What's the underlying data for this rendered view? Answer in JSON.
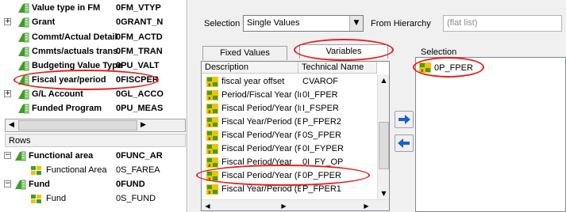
{
  "left_tree": {
    "items": [
      {
        "name": "Value type in FM",
        "tech": "0FM_VTYP",
        "expander": ""
      },
      {
        "name": "Grant",
        "tech": "0GRANT_N",
        "expander": "+"
      },
      {
        "name": "Commt/Actual Detail",
        "tech": "0FM_ACTD",
        "expander": ""
      },
      {
        "name": "Cmmts/actuals trans.",
        "tech": "0FM_TRAN",
        "expander": ""
      },
      {
        "name": "Budgeting Value Type",
        "tech": "0PU_VALT",
        "expander": ""
      },
      {
        "name": "Fiscal year/period",
        "tech": "0FISCPER",
        "expander": ""
      },
      {
        "name": "G/L Account",
        "tech": "0GL_ACCO",
        "expander": "+"
      },
      {
        "name": "Funded Program",
        "tech": "0PU_MEAS",
        "expander": ""
      }
    ],
    "rows_header": "Rows",
    "rows": [
      {
        "name": "Functional area",
        "tech": "0FUNC_AR",
        "expander": "−",
        "bold": true,
        "indent": 0
      },
      {
        "name": "Functional Area",
        "tech": "0S_FAREA",
        "expander": "",
        "bold": false,
        "indent": 1
      },
      {
        "name": "Fund",
        "tech": "0FUND",
        "expander": "−",
        "bold": true,
        "indent": 0
      },
      {
        "name": "Fund",
        "tech": "0S_FUND",
        "expander": "",
        "bold": false,
        "indent": 1
      }
    ]
  },
  "topbar": {
    "selection_label": "Selection",
    "selection_value": "Single Values",
    "hierarchy_label": "From Hierarchy",
    "hierarchy_value": "(flat list)"
  },
  "tabs": {
    "fixed_values": "Fixed Values",
    "variables": "Variables"
  },
  "list": {
    "col_description": "Description",
    "col_technical": "Technical Name",
    "rows": [
      {
        "desc": "fiscal year offset",
        "tech": "CVAROF"
      },
      {
        "desc": "Period/Fiscal Year (Int",
        "tech": "0I_FPER"
      },
      {
        "desc": "Fiscal Period/Year (Inte",
        "tech": "I_FSPER"
      },
      {
        "desc": "Fiscal Year/Period (Exi",
        "tech": "P_FPER2"
      },
      {
        "desc": "Fiscal Period/Year (Re",
        "tech": "0S_FPER"
      },
      {
        "desc": "Fiscal Period/Year (Re",
        "tech": "0I_FYPER"
      },
      {
        "desc": "Fiscal Period/Year",
        "tech": "0I_FY_OP"
      },
      {
        "desc": "Fiscal Period/Year (Re",
        "tech": "0P_FPER"
      },
      {
        "desc": "Fiscal Year/Period (Exi",
        "tech": "P_FPER1"
      }
    ]
  },
  "selection_panel": {
    "label": "Selection",
    "items": [
      {
        "name": "0P_FPER"
      }
    ]
  },
  "icons": {
    "arrow_right": "→",
    "arrow_left": "←",
    "combo_arrow": "▼",
    "scroll_left": "◀",
    "scroll_right": "▶",
    "scroll_up": "▲",
    "scroll_down": "▼"
  },
  "colors": {
    "highlight_ring": "#e8201c",
    "arrow_blue": "#1a5fd6",
    "variable_icon_yellow": "#f2c200",
    "variable_icon_green": "#3f9e2a"
  }
}
